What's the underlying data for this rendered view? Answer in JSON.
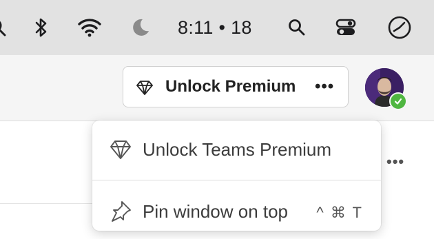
{
  "menubar": {
    "clock": "8:11 • 18",
    "icons": [
      "search-icon-partial",
      "bluetooth-icon",
      "wifi-icon",
      "moon-icon",
      "search-icon",
      "control-center-icon",
      "clock-icon"
    ]
  },
  "header": {
    "premium_button": {
      "label": "Unlock Premium",
      "more": "•••",
      "icon": "gem-icon"
    },
    "avatar": {
      "status": "online",
      "status_color": "#4fb640"
    }
  },
  "content": {
    "more_label": "•••"
  },
  "dropdown": {
    "items": [
      {
        "label": "Unlock Teams Premium",
        "icon": "gem-icon"
      },
      {
        "label": "Pin window on top",
        "icon": "pin-icon",
        "shortcut": "^ ⌘ T"
      }
    ]
  }
}
